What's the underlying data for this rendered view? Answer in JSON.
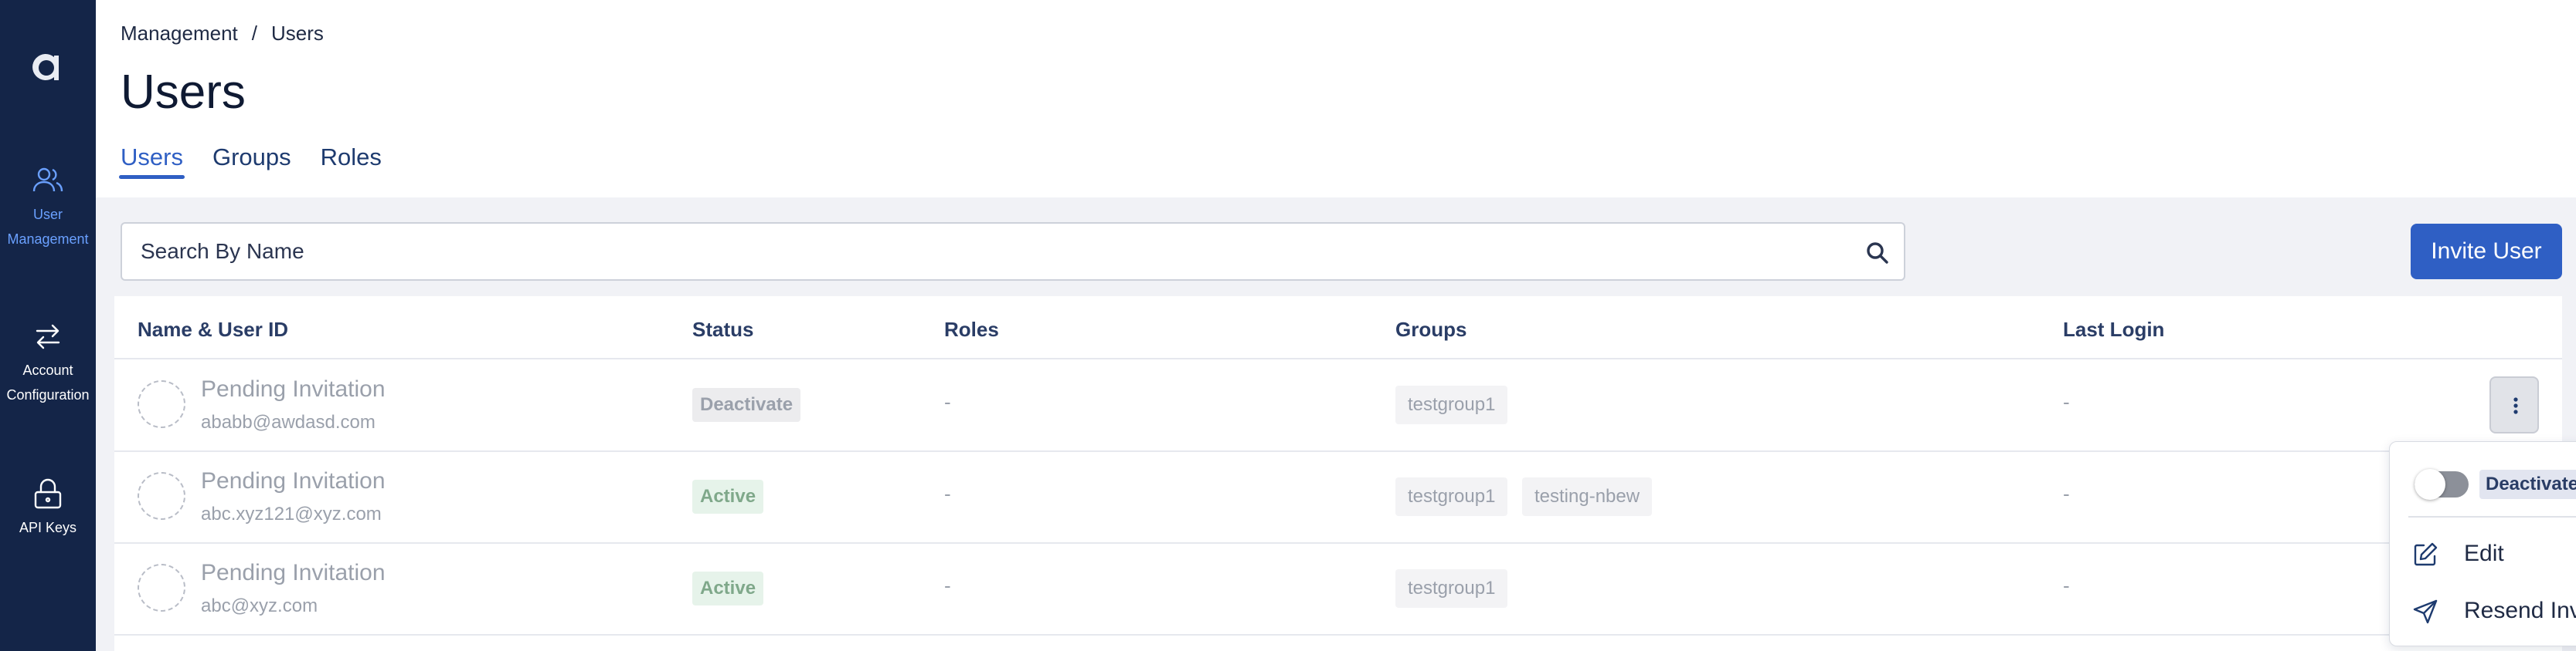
{
  "sidebar": {
    "items": [
      {
        "label_line1": "User",
        "label_line2": "Management"
      },
      {
        "label_line1": "Account",
        "label_line2": "Configuration"
      },
      {
        "label_line1": "API Keys"
      }
    ]
  },
  "breadcrumb": {
    "parent": "Management",
    "separator": "/",
    "current": "Users"
  },
  "page_title": "Users",
  "tabs": [
    {
      "label": "Users",
      "active": true
    },
    {
      "label": "Groups",
      "active": false
    },
    {
      "label": "Roles",
      "active": false
    }
  ],
  "search": {
    "placeholder": "Search By Name",
    "value": ""
  },
  "invite_button": "Invite User",
  "table": {
    "columns": [
      "Name & User ID",
      "Status",
      "Roles",
      "Groups",
      "Last Login"
    ],
    "rows": [
      {
        "name": "Pending Invitation",
        "email": "ababb@awdasd.com",
        "status": "Deactivate",
        "roles": "-",
        "groups": [
          "testgroup1"
        ],
        "last_login": "-"
      },
      {
        "name": "Pending Invitation",
        "email": "abc.xyz121@xyz.com",
        "status": "Active",
        "roles": "-",
        "groups": [
          "testgroup1",
          "testing-nbew"
        ],
        "last_login": "-"
      },
      {
        "name": "Pending Invitation",
        "email": "abc@xyz.com",
        "status": "Active",
        "roles": "-",
        "groups": [
          "testgroup1"
        ],
        "last_login": "-"
      }
    ]
  },
  "row_menu": {
    "toggle_label": "Deactivate",
    "toggle_on": false,
    "items": [
      {
        "label": "Edit",
        "icon": "edit-icon"
      },
      {
        "label": "Resend Invite",
        "icon": "send-icon"
      }
    ]
  },
  "colors": {
    "sidebar_bg": "#142548",
    "accent": "#2f5fc4",
    "active_nav": "#6aa0ff",
    "content_bg": "#f1f2f6"
  }
}
